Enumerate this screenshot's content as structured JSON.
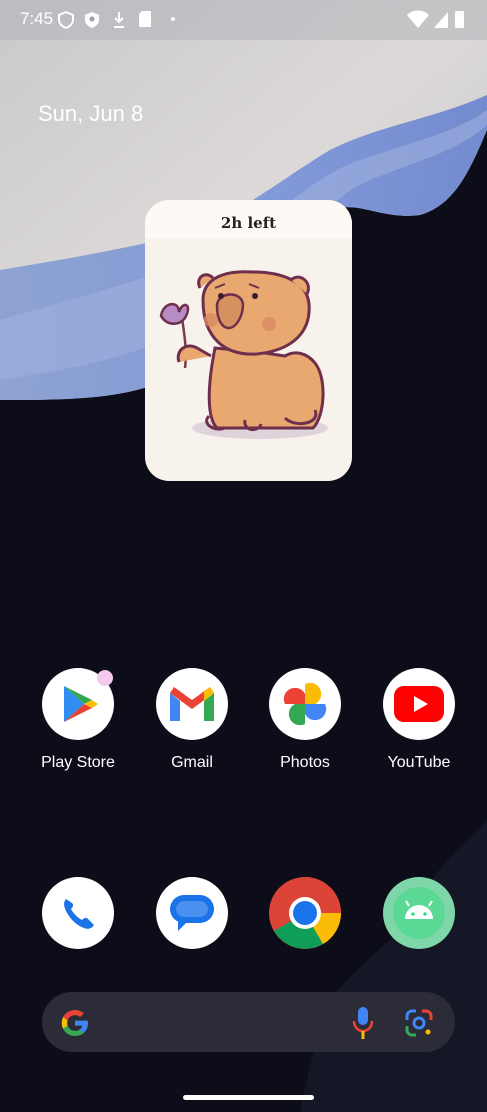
{
  "status_bar": {
    "time": "7:45",
    "left_icons": [
      "vpn-shield-icon",
      "shield-check-icon",
      "download-icon",
      "sd-card-icon",
      "notification-dot-icon"
    ],
    "right_icons": [
      "wifi-icon",
      "cellular-signal-icon",
      "battery-icon"
    ]
  },
  "date": "Sun, Jun 8",
  "widget": {
    "header": "2h left",
    "image": "sad-capybara-holding-flower"
  },
  "apps_row1": [
    {
      "label": "Play Store",
      "icon": "play-store-icon",
      "badge": true
    },
    {
      "label": "Gmail",
      "icon": "gmail-icon"
    },
    {
      "label": "Photos",
      "icon": "photos-icon"
    },
    {
      "label": "YouTube",
      "icon": "youtube-icon"
    }
  ],
  "dock": [
    {
      "icon": "phone-icon"
    },
    {
      "icon": "messages-icon"
    },
    {
      "icon": "chrome-icon"
    },
    {
      "icon": "android-icon"
    }
  ],
  "search": {
    "icons": [
      "google-g-icon",
      "microphone-icon",
      "google-lens-icon"
    ]
  },
  "colors": {
    "background": "#0c0d19",
    "wallpaper_blue": "#7b95d8",
    "widget_bg": "#f7f2ec",
    "search_bg": "#2b2c38",
    "capybara": "#e9a86f"
  }
}
